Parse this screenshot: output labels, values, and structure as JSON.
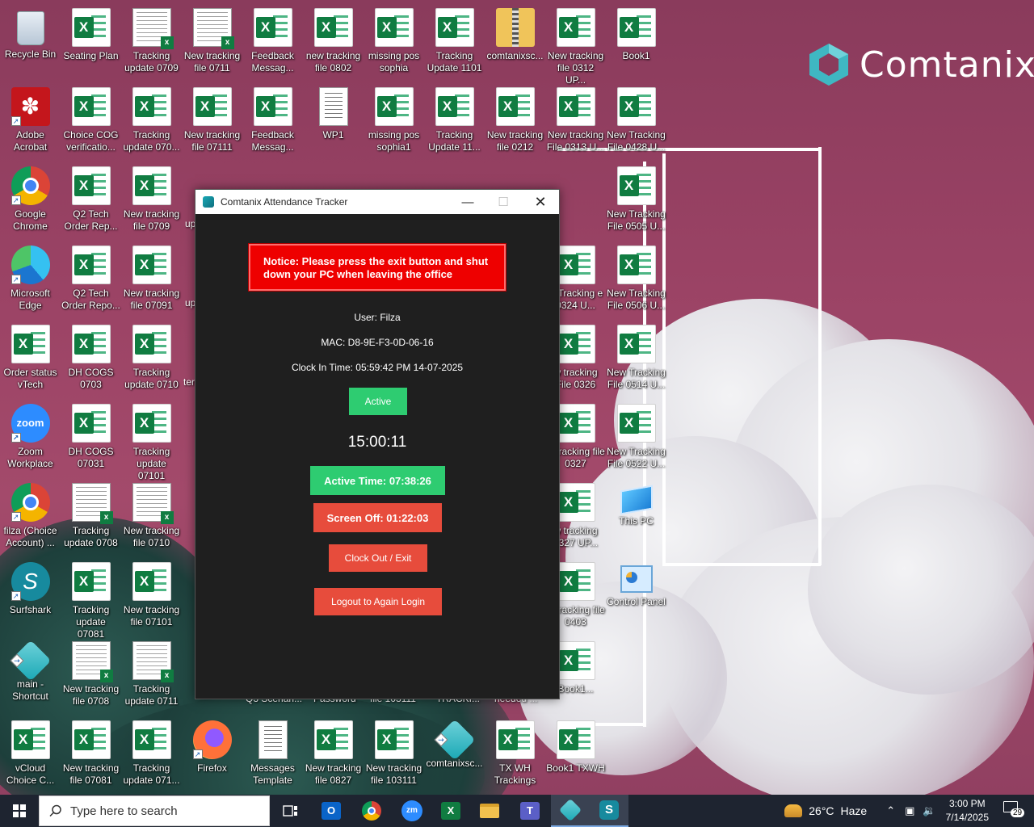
{
  "brand": {
    "name": "Comtanix",
    "color": "#3fb7c2"
  },
  "desktop_icons": [
    {
      "label": "Recycle Bin",
      "icon": "recycle-bin-icon"
    },
    {
      "label": "Seating Plan",
      "icon": "excel-icon"
    },
    {
      "label": "Tracking update 0709",
      "icon": "spreadsheet-icon"
    },
    {
      "label": "New tracking file 0711",
      "icon": "spreadsheet-icon"
    },
    {
      "label": "Feedback Messag...",
      "icon": "excel-icon"
    },
    {
      "label": "new tracking file 0802",
      "icon": "excel-icon"
    },
    {
      "label": "missing pos sophia",
      "icon": "excel-icon"
    },
    {
      "label": "Tracking Update 1101",
      "icon": "excel-icon"
    },
    {
      "label": "comtanixsc...",
      "icon": "zip-folder-icon"
    },
    {
      "label": "New tracking file 0312 UP...",
      "icon": "excel-icon"
    },
    {
      "label": "Book1",
      "icon": "excel-icon"
    },
    {
      "label": "Adobe Acrobat",
      "icon": "acrobat-icon"
    },
    {
      "label": "Choice COG verificatio...",
      "icon": "excel-icon"
    },
    {
      "label": "Tracking update 070...",
      "icon": "excel-icon"
    },
    {
      "label": "New tracking file 07111",
      "icon": "excel-icon"
    },
    {
      "label": "Feedback Messag...",
      "icon": "excel-icon"
    },
    {
      "label": "WP1",
      "icon": "text-icon"
    },
    {
      "label": "missing pos sophia1",
      "icon": "excel-icon"
    },
    {
      "label": "Tracking Update 11...",
      "icon": "excel-icon"
    },
    {
      "label": "New tracking file 0212",
      "icon": "excel-icon"
    },
    {
      "label": "New tracking File 0313 U...",
      "icon": "excel-icon"
    },
    {
      "label": "New Tracking File 0428 U...",
      "icon": "excel-icon"
    },
    {
      "label": "Google Chrome",
      "icon": "chrome-icon"
    },
    {
      "label": "Q2 Tech Order Rep...",
      "icon": "excel-icon"
    },
    {
      "label": "New tracking file 0709",
      "icon": "excel-icon"
    },
    {
      "label": "New Tracking File 0505 U...",
      "icon": "excel-icon"
    },
    {
      "label": "Microsoft Edge",
      "icon": "edge-icon"
    },
    {
      "label": "Q2 Tech Order Repo...",
      "icon": "excel-icon"
    },
    {
      "label": "New tracking file 07091",
      "icon": "excel-icon"
    },
    {
      "label": "w Tracking e 0324 U...",
      "icon": "excel-icon"
    },
    {
      "label": "New Tracking File 0506 U...",
      "icon": "excel-icon"
    },
    {
      "label": "Order status vTech",
      "icon": "excel-icon"
    },
    {
      "label": "DH COGS 0703",
      "icon": "excel-icon"
    },
    {
      "label": "Tracking update 0710",
      "icon": "excel-icon"
    },
    {
      "label": "w tracking File 0326",
      "icon": "excel-icon"
    },
    {
      "label": "New Tracking File 0514 U...",
      "icon": "excel-icon"
    },
    {
      "label": "Zoom Workplace",
      "icon": "zoom-icon"
    },
    {
      "label": "DH COGS 07031",
      "icon": "excel-icon"
    },
    {
      "label": "Tracking update 07101",
      "icon": "excel-icon"
    },
    {
      "label": "w tracking file 0327",
      "icon": "excel-icon"
    },
    {
      "label": "New Tracking File 0522 U...",
      "icon": "excel-icon"
    },
    {
      "label": "filza (Choice Account) ...",
      "icon": "chrome-icon"
    },
    {
      "label": "Tracking update 0708",
      "icon": "spreadsheet-icon"
    },
    {
      "label": "New tracking file 0710",
      "icon": "spreadsheet-icon"
    },
    {
      "label": "w tracking 0327 UP...",
      "icon": "excel-icon"
    },
    {
      "label": "This PC",
      "icon": "this-pc-icon"
    },
    {
      "label": "Surfshark",
      "icon": "surfshark-icon"
    },
    {
      "label": "Tracking update 07081",
      "icon": "excel-icon"
    },
    {
      "label": "New tracking file 07101",
      "icon": "excel-icon"
    },
    {
      "label": "w tracking file 0403",
      "icon": "excel-icon"
    },
    {
      "label": "Control Panel",
      "icon": "control-panel-icon"
    },
    {
      "label": "main - Shortcut",
      "icon": "comtanix-icon"
    },
    {
      "label": "New tracking file 0708",
      "icon": "spreadsheet-icon"
    },
    {
      "label": "Tracking update 0711",
      "icon": "spreadsheet-icon"
    },
    {
      "label": "Book1...",
      "icon": "excel-icon"
    },
    {
      "label": "vCloud Choice C...",
      "icon": "excel-icon"
    },
    {
      "label": "New tracking file 07081",
      "icon": "excel-icon"
    },
    {
      "label": "Tracking update 071...",
      "icon": "excel-icon"
    },
    {
      "label": "Firefox",
      "icon": "firefox-icon"
    },
    {
      "label": "Messages Template",
      "icon": "text-icon"
    },
    {
      "label": "New tracking file 0827",
      "icon": "excel-icon"
    },
    {
      "label": "New tracking file 103111",
      "icon": "excel-icon"
    },
    {
      "label": "comtanixsc...",
      "icon": "comtanix-icon"
    },
    {
      "label": "TX WH Trackings",
      "icon": "excel-icon"
    },
    {
      "label": "Book1 TXWH",
      "icon": "excel-icon"
    }
  ],
  "partial_labels": [
    "up",
    "up",
    "ter",
    "F N",
    "Q3 Scenari...",
    "Password",
    "file 103111",
    "TRACKI...",
    "needed ..."
  ],
  "window": {
    "title": "Comtanix Attendance Tracker",
    "notice": "Notice: Please press the exit button and shut down your PC when leaving the office",
    "user": "User: Filza",
    "mac": "MAC: D8-9E-F3-0D-06-16",
    "clock_in": "Clock In Time: 05:59:42 PM 14-07-2025",
    "status": "Active",
    "clock": "15:00:11",
    "active_time": "Active Time: 07:38:26",
    "screen_off": "Screen Off: 01:22:03",
    "clock_out": "Clock Out / Exit",
    "logout": "Logout to Again Login",
    "colors": {
      "green": "#2ecc71",
      "red": "#e74c3c",
      "notice_red": "#ee0000"
    }
  },
  "taskbar": {
    "search_placeholder": "Type here to search",
    "apps": [
      "task-view-icon",
      "outlook-icon",
      "chrome-icon",
      "zoom-icon",
      "excel-icon",
      "file-explorer-icon",
      "teams-icon",
      "comtanix-icon",
      "surfshark-icon"
    ],
    "weather_temp": "26°C",
    "weather_desc": "Haze",
    "time": "3:00 PM",
    "date": "7/14/2025",
    "notification_count": "29"
  }
}
